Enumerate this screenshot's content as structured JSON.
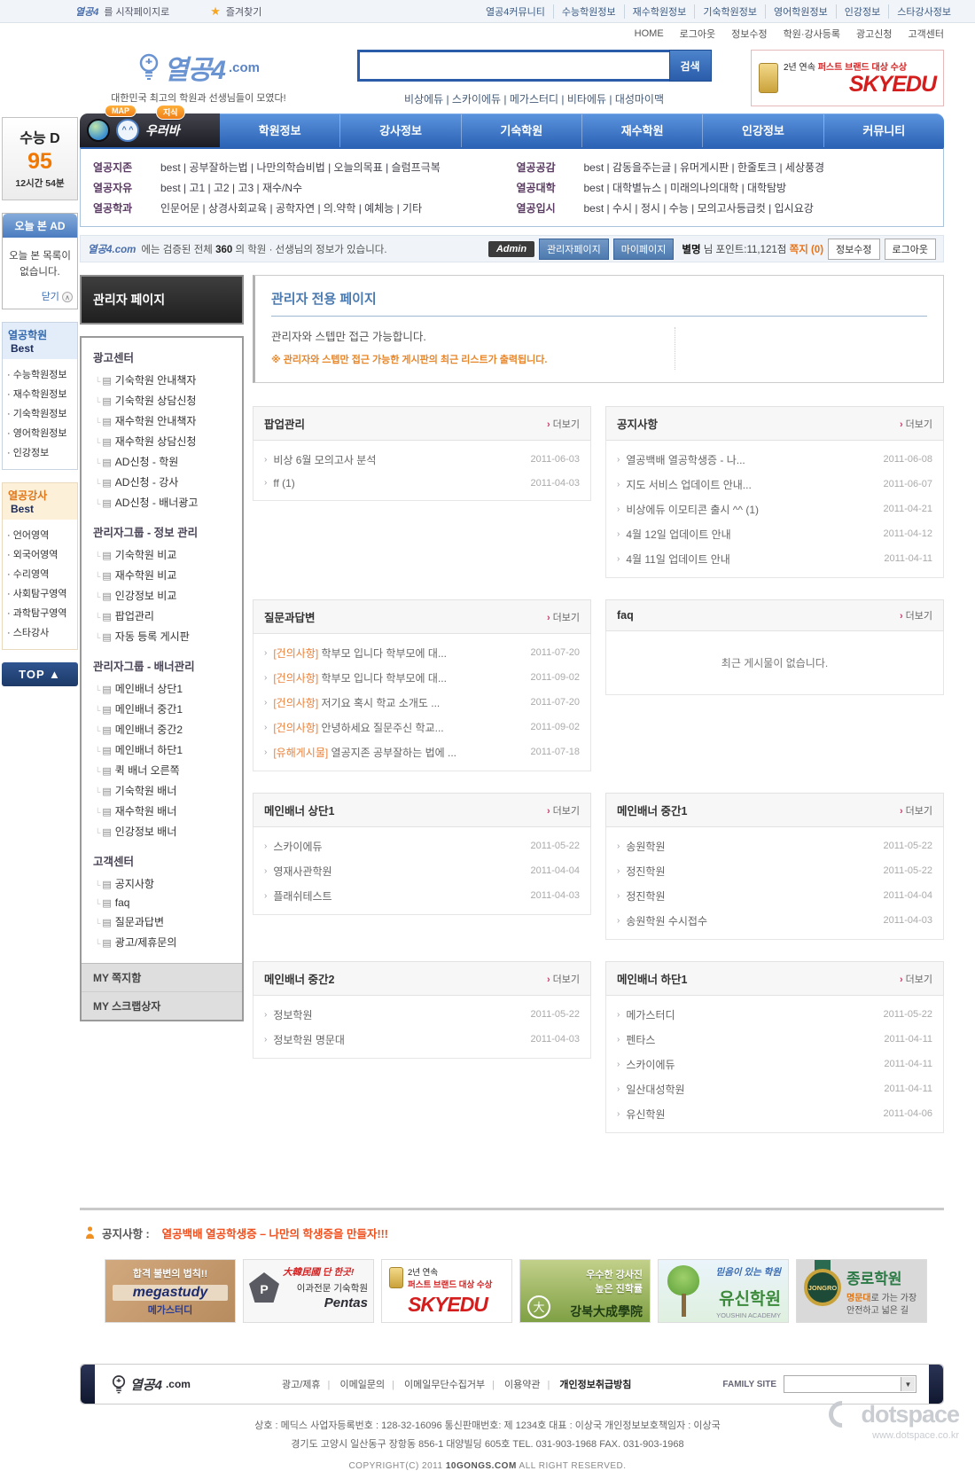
{
  "topbar": {
    "logo": "열공4",
    "start_page": "를 시작페이지로",
    "favorite": "즐겨찾기",
    "links": [
      "열공4커뮤니티",
      "수능학원정보",
      "재수학원정보",
      "기숙학원정보",
      "영어학원정보",
      "인강정보",
      "스타강사정보"
    ],
    "utility": [
      "HOME",
      "로그아웃",
      "정보수정",
      "학원·강사등록",
      "광고신청",
      "고객센터"
    ]
  },
  "header": {
    "logo": "열공4",
    "logo_com": ".com",
    "tagline": "대한민국 최고의 학원과 선생님들이 모였다!",
    "search_button": "검색",
    "quick_links": "비상에듀 | 스카이에듀 | 메가스터디 | 비타에듀 | 대성마이맥",
    "skyedu": {
      "line1": "2년 연속",
      "line2": "퍼스트 브랜드 대상 수상",
      "brand": "SKYEDU"
    }
  },
  "nav": {
    "map_bubble": "MAP",
    "knowledge_bubble": "지식",
    "mascot": "우러바",
    "items": [
      "학원정보",
      "강사정보",
      "기숙학원",
      "재수학원",
      "인강정보",
      "커뮤니티"
    ]
  },
  "subnav": {
    "left": [
      {
        "label": "열공지존",
        "links": "best | 공부잘하는법 | 나만의학습비법 | 오늘의목표 | 슬럼프극복"
      },
      {
        "label": "열공자유",
        "links": "best | 고1 | 고2 | 고3 | 재수/N수"
      },
      {
        "label": "열공학과",
        "links": "인문어문 | 상경사회교육 | 공학자연 | 의.약학 | 예체능 | 기타"
      }
    ],
    "right": [
      {
        "label": "열공공감",
        "links": "best | 감동을주는글 | 유머게시판 | 한줄토크 | 세상풍경"
      },
      {
        "label": "열공대학",
        "links": "best | 대학별뉴스 | 미래의나의대학 | 대학탐방"
      },
      {
        "label": "열공입시",
        "links": "best | 수시 | 정시 | 수능 | 모의고사등급컷 | 입시요강"
      }
    ]
  },
  "infobar": {
    "site": "열공4.com",
    "text_pre": "에는 검증된 전체",
    "count": "360",
    "text_post": "의 학원 · 선생님의 정보가 있습니다.",
    "admin": "Admin",
    "admin_page": "관리자페이지",
    "my_page": "마이페이지",
    "user": "별명",
    "points": "님 포인트:11,121점",
    "memo": "쪽지 (0)",
    "edit": "정보수정",
    "logout": "로그아웃"
  },
  "leftrail": {
    "dday": {
      "label": "수능 D",
      "num": "95",
      "time": "12시간 54분"
    },
    "adbox": {
      "head": "오늘 본 AD",
      "body1": "오늘 본 목록이",
      "body2": "없습니다.",
      "close": "닫기"
    },
    "best1": {
      "title": "열공학원",
      "badge": "Best",
      "items": [
        "수능학원정보",
        "재수학원정보",
        "기숙학원정보",
        "영어학원정보",
        "인강정보"
      ]
    },
    "best2": {
      "title": "열공강사",
      "badge": "Best",
      "items": [
        "언어영역",
        "외국어영역",
        "수리영역",
        "사회탐구영역",
        "과학탐구영역",
        "스타강사"
      ]
    },
    "top": "TOP ▲"
  },
  "admin_sidebar": {
    "title": "관리자 페이지",
    "sections": [
      {
        "title": "광고센터",
        "items": [
          "기숙학원 안내책자",
          "기숙학원 상담신청",
          "재수학원 안내책자",
          "재수학원 상담신청",
          "AD신청 - 학원",
          "AD신청 - 강사",
          "AD신청 - 배너광고"
        ]
      },
      {
        "title": "관리자그룹 - 정보 관리",
        "items": [
          "기숙학원 비교",
          "재수학원 비교",
          "인강정보 비교",
          "팝업관리",
          "자동 등록 게시판"
        ]
      },
      {
        "title": "관리자그룹 - 배너관리",
        "items": [
          "메인배너 상단1",
          "메인배너 중간1",
          "메인배너 중간2",
          "메인배너 하단1",
          "퀵 배너 오른쪽",
          "기숙학원 배너",
          "재수학원 배너",
          "인강정보 배너"
        ]
      },
      {
        "title": "고객센터",
        "items": [
          "공지사항",
          "faq",
          "질문과답변",
          "광고/제휴문의"
        ]
      }
    ],
    "my_items": [
      "MY 쪽지함",
      "MY 스크랩상자"
    ]
  },
  "main": {
    "title": "관리자 전용 페이지",
    "desc": "관리자와 스텝만 접근 가능합니다.",
    "note": "※ 관리자와 스텝만 접근 가능한 게시판의 최근 리스트가 출력됩니다.",
    "more_label": "더보기",
    "panels": [
      {
        "title": "팝업관리",
        "items": [
          {
            "title": "비상 6월 모의고사 분석",
            "date": "2011-06-03"
          },
          {
            "title": "ff (1)",
            "date": "2011-04-03"
          }
        ]
      },
      {
        "title": "공지사항",
        "items": [
          {
            "title": "열공백배 열공학생증 - 나...",
            "date": "2011-06-08"
          },
          {
            "title": "지도 서비스 업데이트 안내...",
            "date": "2011-06-07"
          },
          {
            "title": "비상에듀 이모티콘 출시 ^^ (1)",
            "date": "2011-04-21"
          },
          {
            "title": "4월 12일 업데이트 안내",
            "date": "2011-04-12"
          },
          {
            "title": "4월 11일 업데이트 안내",
            "date": "2011-04-11"
          }
        ]
      },
      {
        "title": "질문과답변",
        "items": [
          {
            "prefix": "[건의사항]",
            "title": " 학부모 입니다 학부모에 대...",
            "date": "2011-07-20"
          },
          {
            "prefix": "[건의사항]",
            "title": " 학부모 입니다 학부모에 대...",
            "date": "2011-09-02"
          },
          {
            "prefix": "[건의사항]",
            "title": " 저기요 혹시 학교 소개도 ...",
            "date": "2011-07-20"
          },
          {
            "prefix": "[건의사항]",
            "title": " 안녕하세요 질문주신 학교...",
            "date": "2011-09-02"
          },
          {
            "prefix": "[유해게시물]",
            "title": " 열공지존 공부잘하는 법에 ...",
            "date": "2011-07-18"
          }
        ]
      },
      {
        "title": "faq",
        "empty": "최근 게시물이 없습니다."
      },
      {
        "title": "메인배너 상단1",
        "items": [
          {
            "title": "스카이에듀",
            "date": "2011-05-22"
          },
          {
            "title": "영재사관학원",
            "date": "2011-04-04"
          },
          {
            "title": "플래쉬테스트",
            "date": "2011-04-03"
          }
        ]
      },
      {
        "title": "메인배너 중간1",
        "items": [
          {
            "title": "송원학원",
            "date": "2011-05-22"
          },
          {
            "title": "정진학원",
            "date": "2011-05-22"
          },
          {
            "title": "정진학원",
            "date": "2011-04-04"
          },
          {
            "title": "송원학원 수시접수",
            "date": "2011-04-03"
          }
        ]
      },
      {
        "title": "메인배너 중간2",
        "items": [
          {
            "title": "정보학원",
            "date": "2011-05-22"
          },
          {
            "title": "정보학원 명문대",
            "date": "2011-04-03"
          }
        ]
      },
      {
        "title": "메인배너 하단1",
        "items": [
          {
            "title": "메가스터디",
            "date": "2011-05-22"
          },
          {
            "title": "펜타스",
            "date": "2011-04-11"
          },
          {
            "title": "스카이에듀",
            "date": "2011-04-11"
          },
          {
            "title": "일산대성학원",
            "date": "2011-04-11"
          },
          {
            "title": "유신학원",
            "date": "2011-04-06"
          }
        ]
      }
    ]
  },
  "notice": {
    "label": "공지사항 :",
    "text": "열공백배 열공학생증 – 나만의 학생증을 만들자!!!"
  },
  "banners": [
    {
      "line1": "합격 불변의 법칙!!",
      "brand": "megastudy",
      "sub": "메가스터디"
    },
    {
      "line1": "大韓民國 단 한곳!",
      "line2": "이과전문 기숙학원",
      "brand": "Pentas",
      "initial": "P"
    },
    {
      "line1": "2년 연속",
      "line2": "퍼스트 브랜드 대상 수상",
      "brand": "SKYEDU"
    },
    {
      "line1": "우수한 강사진",
      "line2": "높은 진학률",
      "brand": "강북大成學院",
      "initial": "大"
    },
    {
      "line1": "믿음이 있는 학원",
      "brand": "유신학원",
      "sub": "YOUSHIN ACADEMY"
    },
    {
      "medal": "JONGRO",
      "brand": "종로학원",
      "line1": "명문대",
      "line2": "로 가는 가장 안전하고 넓은 길"
    }
  ],
  "footer": {
    "logo": "열공4",
    "logo_com": ".com",
    "links": [
      "광고/제휴",
      "이메일문의",
      "이메일무단수집거부",
      "이용약관",
      "개인정보취급방침"
    ],
    "family": "FAMILY SITE",
    "info1": "상호 : 메딕스    사업자등록번호 : 128-32-16096    통신판매번호: 제 1234호    대표 : 이상국    개인정보보호책임자 : 이상국",
    "info2": "경기도 고양시 일산동구 장항동 856-1 대양빌딩 605호    TEL. 031-903-1968    FAX. 031-903-1968",
    "copy_pre": "COPYRIGHT(C) 2011 ",
    "copy_site": "10GONGS.COM",
    "copy_post": " ALL RIGHT RESERVED.",
    "watermark": "dotspace",
    "watermark_url": "www.dotspace.co.kr"
  }
}
